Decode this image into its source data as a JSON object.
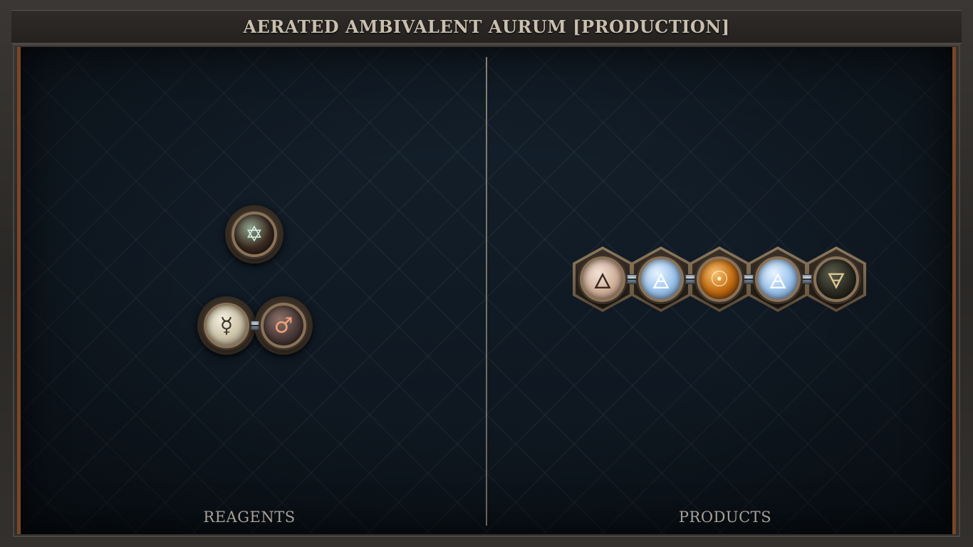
{
  "title": "AERATED AMBIVALENT AURUM [PRODUCTION]",
  "reagents_label": "REAGENTS",
  "products_label": "PRODUCTS",
  "reagents": [
    {
      "molecule": 1,
      "atoms": [
        {
          "element": "salt",
          "symbol": "✡"
        }
      ]
    },
    {
      "molecule": 2,
      "atoms": [
        {
          "element": "quicksilver",
          "symbol": "☿"
        },
        {
          "element": "iron",
          "symbol": "♂"
        }
      ]
    }
  ],
  "products": [
    {
      "molecule": 1,
      "atoms": [
        {
          "element": "vitae",
          "symbol": "🜂"
        },
        {
          "element": "air",
          "symbol": "🜁"
        },
        {
          "element": "gold",
          "symbol": "☉"
        },
        {
          "element": "air",
          "symbol": "🜁"
        },
        {
          "element": "mors",
          "symbol": "🜃"
        }
      ]
    }
  ],
  "colors": {
    "frame": "#2a2826",
    "board": "#0f1822",
    "accent_copper": "#7a4626",
    "title_text": "#c9bfae",
    "label_text": "#a7a097"
  }
}
